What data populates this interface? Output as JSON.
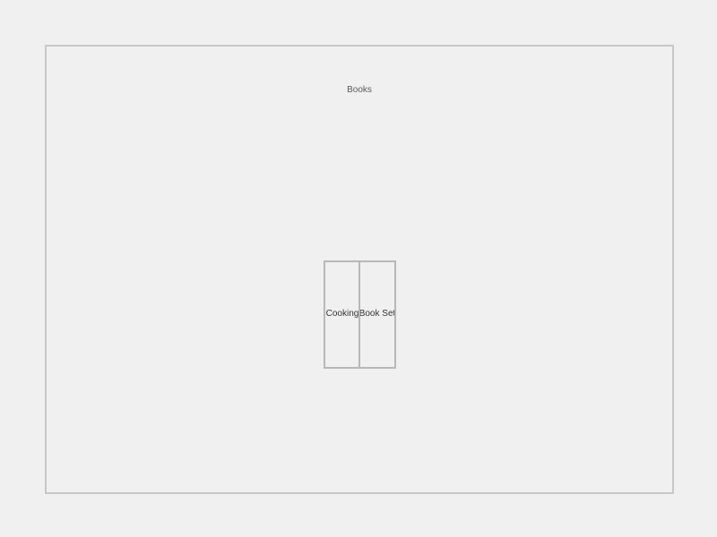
{
  "frame": {
    "title": "Books"
  },
  "books": [
    {
      "label": "Cooking"
    },
    {
      "label": "Book Set"
    }
  ],
  "colors": {
    "background": "#f0f0f0",
    "frame_border": "#c8c8c8",
    "book_border": "#b8b8b8",
    "text": "#333333"
  }
}
